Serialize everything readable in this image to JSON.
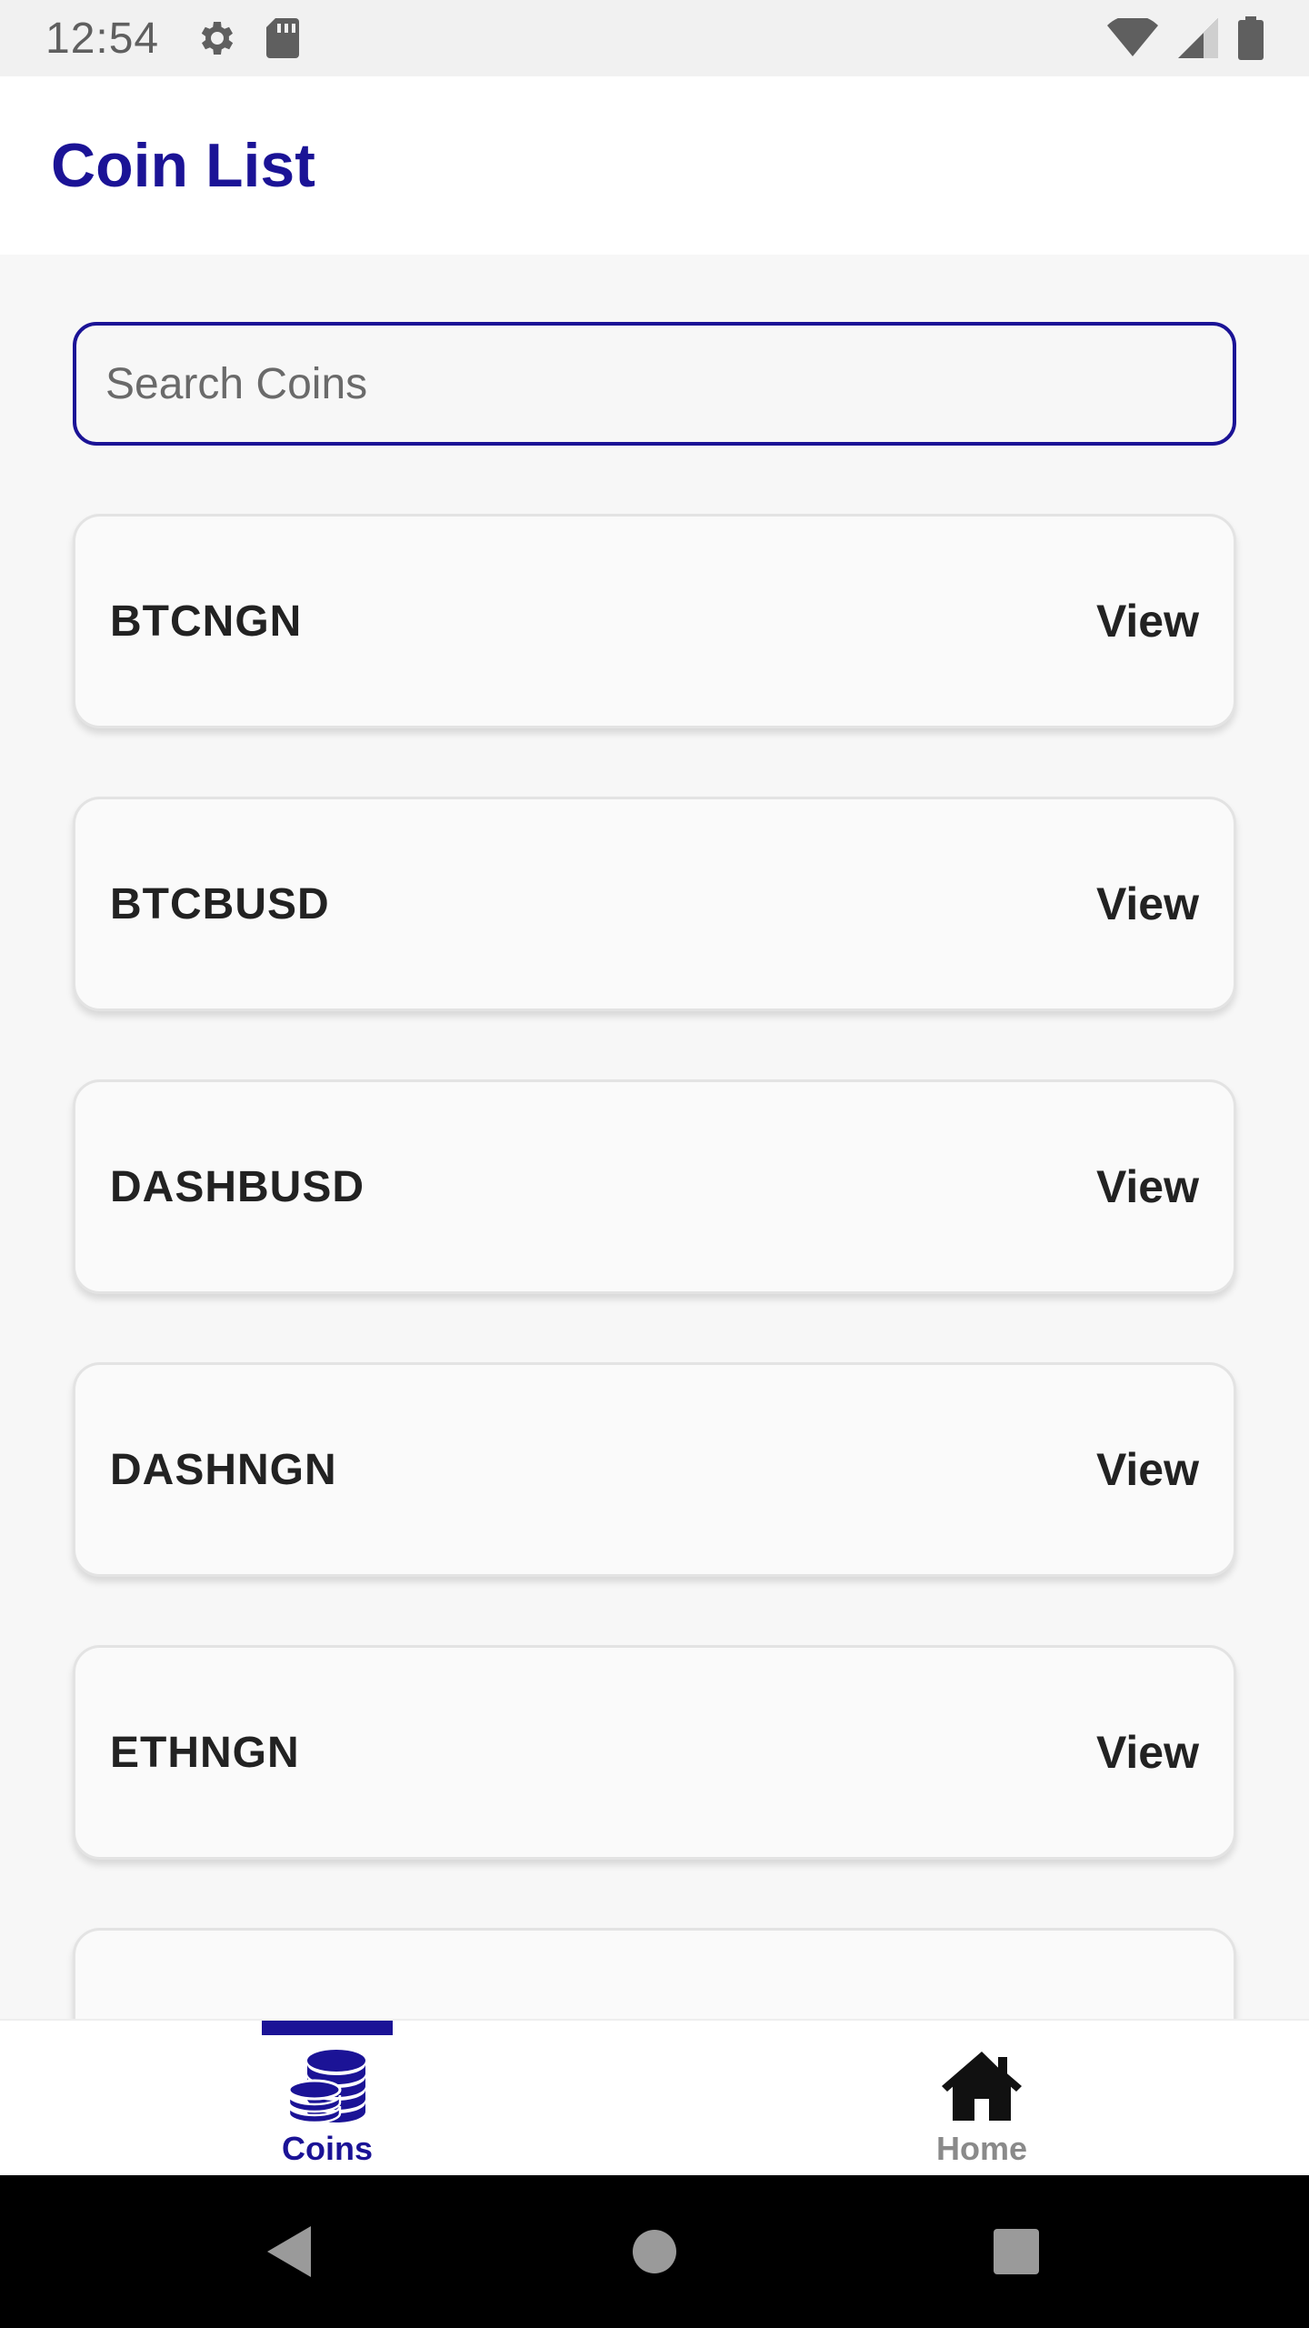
{
  "status_bar": {
    "time": "12:54",
    "left_icons": [
      "gear-icon",
      "sd-card-icon"
    ],
    "right_icons": [
      "wifi-icon",
      "signal-icon",
      "battery-icon"
    ]
  },
  "app_bar": {
    "title": "Coin List"
  },
  "search": {
    "placeholder": "Search Coins",
    "value": ""
  },
  "coins": [
    {
      "name": "BTCNGN",
      "action": "View"
    },
    {
      "name": "BTCBUSD",
      "action": "View"
    },
    {
      "name": "DASHBUSD",
      "action": "View"
    },
    {
      "name": "DASHNGN",
      "action": "View"
    },
    {
      "name": "ETHNGN",
      "action": "View"
    },
    {
      "name": "",
      "action": ""
    }
  ],
  "bottom_nav": {
    "items": [
      {
        "label": "Coins",
        "icon": "coins-icon",
        "active": true
      },
      {
        "label": "Home",
        "icon": "home-icon",
        "active": false
      }
    ]
  },
  "system_nav": {
    "icons": [
      "back-icon",
      "home-circle-icon",
      "recents-icon"
    ]
  },
  "colors": {
    "accent": "#1b1396",
    "inactive": "#8a8a8a"
  }
}
